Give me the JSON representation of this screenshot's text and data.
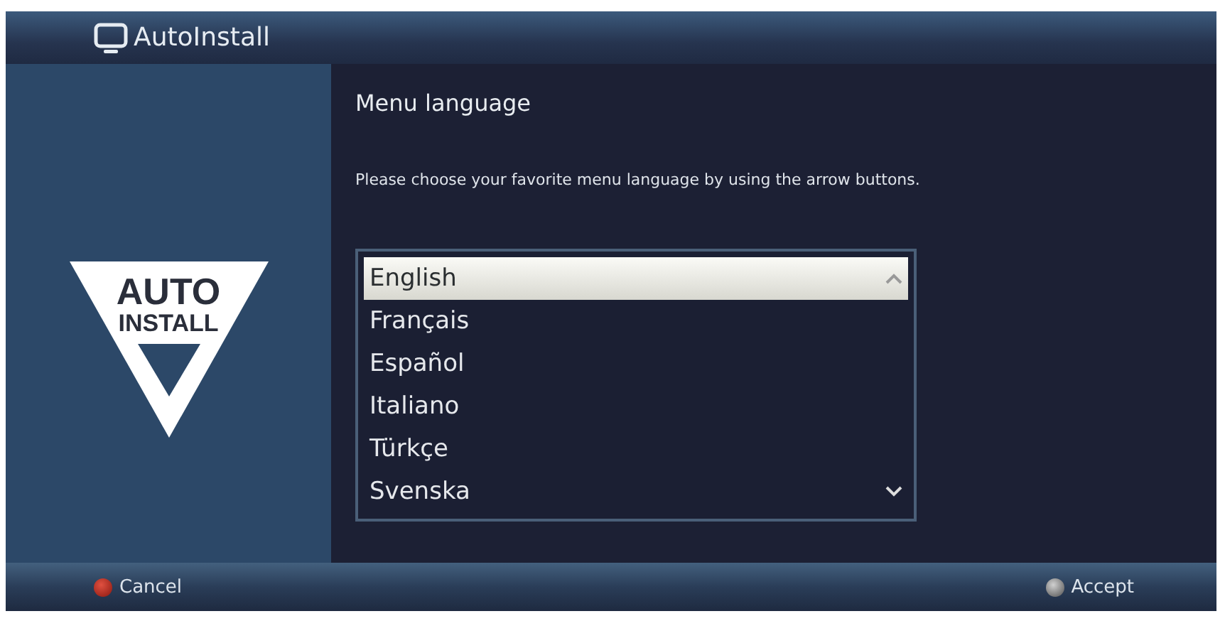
{
  "window": {
    "title": "AutoInstall"
  },
  "logo": {
    "line_1": "AUTO",
    "line_2": "INSTALL"
  },
  "heading": "Menu language",
  "instruction": "Please choose your favorite menu language by using the arrow buttons.",
  "languages": [
    {
      "label": "English",
      "selected": true
    },
    {
      "label": "Français",
      "selected": false
    },
    {
      "label": "Español",
      "selected": false
    },
    {
      "label": "Italiano",
      "selected": false
    },
    {
      "label": "Türkçe",
      "selected": false
    },
    {
      "label": "Svenska",
      "selected": false
    }
  ],
  "footer": [
    {
      "label": "Cancel",
      "kind": "red"
    },
    {
      "label": "Accept",
      "kind": "ok"
    }
  ]
}
